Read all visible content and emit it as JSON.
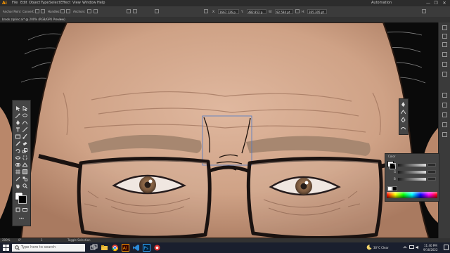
{
  "app": {
    "logo": "Ai",
    "menus": [
      "File",
      "Edit",
      "Object",
      "Type",
      "Select",
      "Effect",
      "View",
      "Window",
      "Help"
    ],
    "workspace": "Automation",
    "window_controls": [
      "—",
      "❐",
      "✕"
    ]
  },
  "control_bar": {
    "selection_label": "Anchor Point",
    "convert_label": "Convert:",
    "handles_label": "Handles:",
    "anchors_label": "Anchors:",
    "x_label": "X:",
    "x_value": "1667.126 p",
    "y_label": "Y:",
    "y_value": "482.852 p",
    "w_label": "W:",
    "w_value": "92.594 pt",
    "h_label": "H:",
    "h_value": "265.305 pt"
  },
  "document": {
    "tab_title": "brook ziplinc.ai* @ 200% (RGB/GPU Preview)",
    "close": "×"
  },
  "color_panel": {
    "title": "Color",
    "channels": [
      {
        "name": "R",
        "value": ""
      },
      {
        "name": "G",
        "value": ""
      },
      {
        "name": "B",
        "value": ""
      }
    ]
  },
  "status_bar": {
    "zoom": "200%",
    "angle": "0°",
    "page": "1",
    "tool": "Toggle Selection"
  },
  "taskbar": {
    "search_placeholder": "Type here to search",
    "weather": "30°C  Clear",
    "time": "11:40 PM",
    "date": "9/16/2022"
  },
  "colors": {
    "accent": "#ff9a00",
    "ui_dark": "#2c2c2c",
    "ui_panel": "#444444",
    "skin": "#c99a7e",
    "eyebrow": "#a78770",
    "iris": "#7a5436",
    "selection": "#4a78c8"
  }
}
